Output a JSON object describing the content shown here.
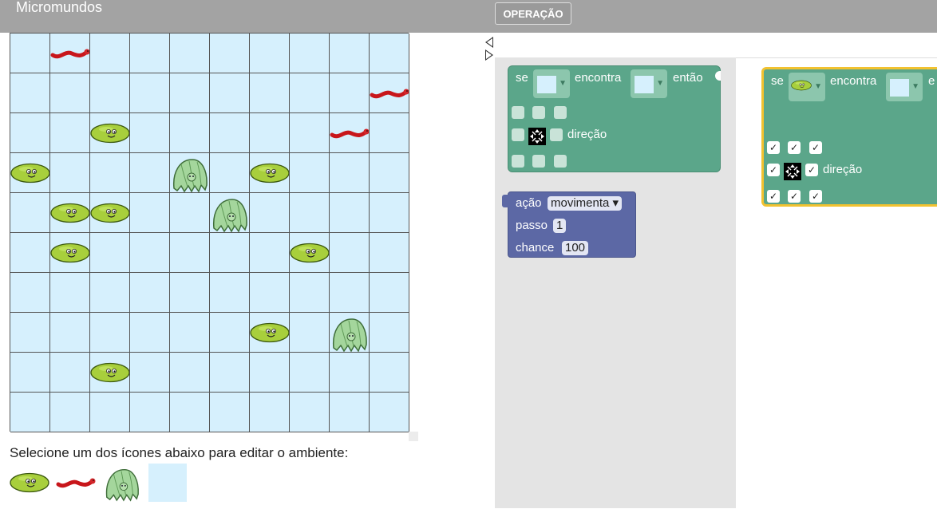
{
  "app": {
    "title": "Micromundos"
  },
  "toolbar": {
    "operation_label": "OPERAÇÃO"
  },
  "grid": {
    "rows": 10,
    "cols": 10,
    "cells": [
      [
        "",
        "worm",
        "",
        "",
        "",
        "",
        "",
        "",
        "",
        ""
      ],
      [
        "",
        "",
        "",
        "",
        "",
        "",
        "",
        "",
        "",
        "worm"
      ],
      [
        "",
        "",
        "bean",
        "",
        "",
        "",
        "",
        "",
        "worm",
        ""
      ],
      [
        "bean",
        "",
        "",
        "",
        "tardigrade",
        "",
        "bean",
        "",
        "",
        ""
      ],
      [
        "",
        "bean",
        "bean",
        "",
        "",
        "tardigrade",
        "",
        "",
        "",
        ""
      ],
      [
        "",
        "bean",
        "",
        "",
        "",
        "",
        "",
        "bean",
        "",
        ""
      ],
      [
        "",
        "",
        "",
        "",
        "",
        "",
        "",
        "",
        "",
        ""
      ],
      [
        "",
        "",
        "",
        "",
        "",
        "",
        "bean",
        "",
        "tardigrade",
        ""
      ],
      [
        "",
        "",
        "bean",
        "",
        "",
        "",
        "",
        "",
        "",
        ""
      ],
      [
        "",
        "",
        "",
        "",
        "",
        "",
        "",
        "",
        "",
        ""
      ]
    ]
  },
  "editor": {
    "prompt": "Selecione um dos ícones abaixo para editar o ambiente:"
  },
  "palette": [
    "bean",
    "worm",
    "tardigrade",
    "empty"
  ],
  "blocks": {
    "rule1": {
      "kw_if": "se",
      "kw_finds": "encontra",
      "kw_then": "então",
      "kw_direction": "direção"
    },
    "rule2": {
      "kw_if": "se",
      "kw_finds": "encontra",
      "kw_then": "e",
      "kw_direction": "direção"
    },
    "action": {
      "kw_action": "ação",
      "action_value": "movimenta ▾",
      "kw_step": "passo",
      "step_value": "1",
      "kw_chance": "chance",
      "chance_value": "100"
    }
  },
  "colors": {
    "rule_block": "#5ba68a",
    "action_block": "#5c68a5",
    "selected_outline": "#f2c230",
    "grid_cell": "#d6f0fd",
    "topbar": "#a3a3a3"
  }
}
